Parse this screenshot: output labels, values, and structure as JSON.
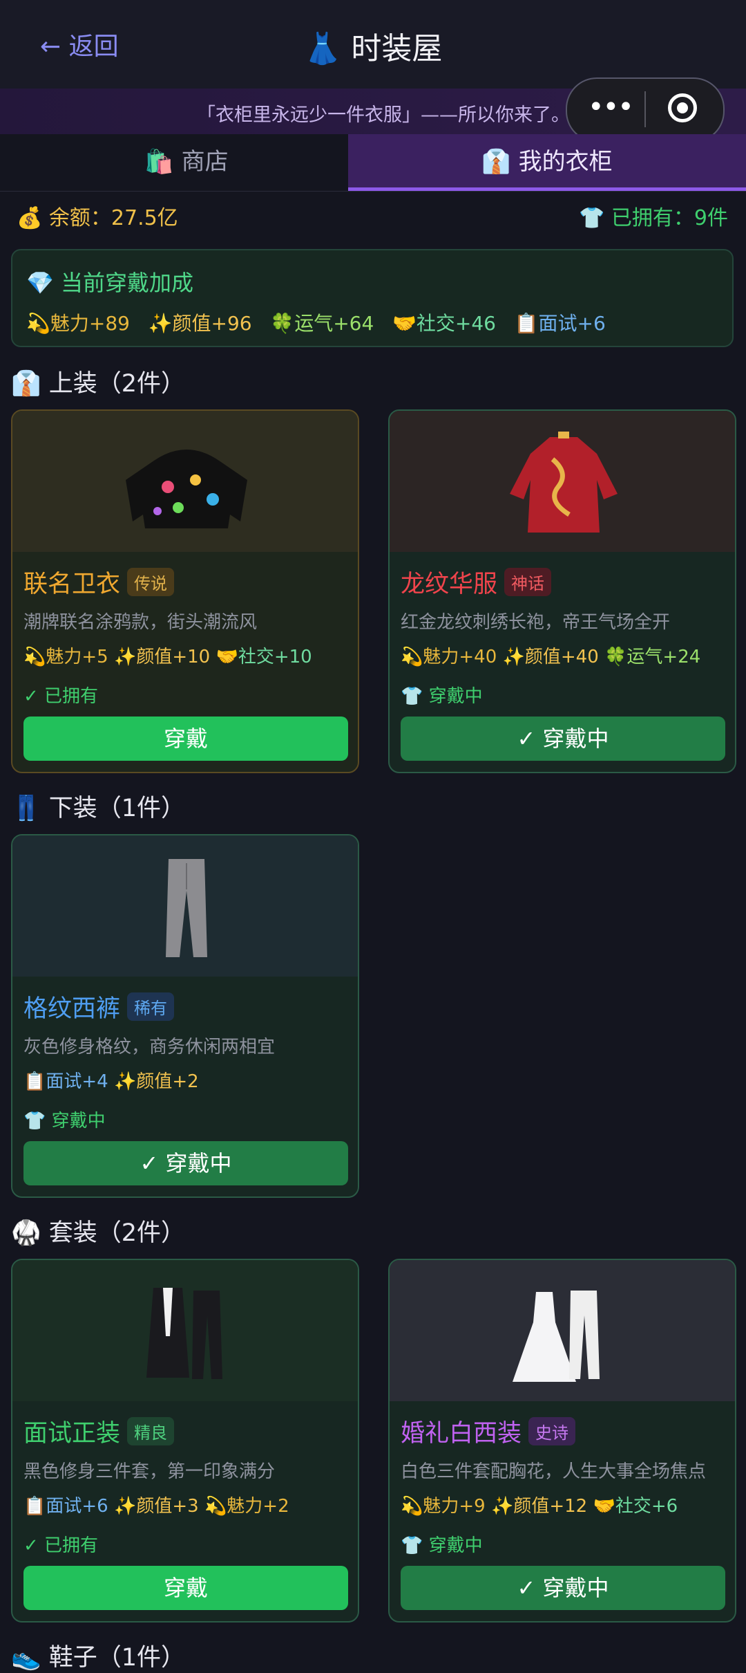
{
  "header": {
    "back_label": "← 返回",
    "title": "👗 时装屋"
  },
  "banner": {
    "quote": "「衣柜里永远少一件衣服」——所以你来了。"
  },
  "tabs": [
    {
      "label": "🛍️ 商店"
    },
    {
      "label": "👔 我的衣柜"
    }
  ],
  "stats": {
    "balance": "💰 余额：27.5亿",
    "owned": "👕 已拥有：9件"
  },
  "bonus": {
    "title": "💎 当前穿戴加成",
    "items": [
      {
        "label": "💫魅力+89",
        "color": "#e8b73c"
      },
      {
        "label": "✨颜值+96",
        "color": "#f2c24f"
      },
      {
        "label": "🍀运气+64",
        "color": "#9be06a"
      },
      {
        "label": "🤝社交+46",
        "color": "#6fdca0"
      },
      {
        "label": "📋面试+6",
        "color": "#6fb0ee"
      }
    ]
  },
  "sections": {
    "tops": "👔 上装（2件）",
    "bottoms": "👖 下装（1件）",
    "suits": "🥋 套装（2件）",
    "shoes": "👟 鞋子（1件）"
  },
  "cards": [
    {
      "name": "联名卫衣",
      "rarity": "传说",
      "desc": "潮牌联名涂鸦款，街头潮流风",
      "attrs": [
        {
          "t": "💫魅力+5",
          "c": "#e8b73c"
        },
        {
          "t": "✨颜值+10",
          "c": "#f2c24f"
        },
        {
          "t": "🤝社交+10",
          "c": "#6fdca0"
        }
      ],
      "status": "✓ 已拥有",
      "button": "穿戴",
      "name_color": "#f0a830"
    },
    {
      "name": "龙纹华服",
      "rarity": "神话",
      "desc": "红金龙纹刺绣长袍，帝王气场全开",
      "attrs": [
        {
          "t": "💫魅力+40",
          "c": "#e8b73c"
        },
        {
          "t": "✨颜值+40",
          "c": "#f2c24f"
        },
        {
          "t": "🍀运气+24",
          "c": "#9be06a"
        }
      ],
      "status": "👕 穿戴中",
      "button": "✓ 穿戴中",
      "name_color": "#f0444c"
    },
    {
      "name": "格纹西裤",
      "rarity": "稀有",
      "desc": "灰色修身格纹，商务休闲两相宜",
      "attrs": [
        {
          "t": "📋面试+4",
          "c": "#6fb0ee"
        },
        {
          "t": "✨颜值+2",
          "c": "#f2c24f"
        }
      ],
      "status": "👕 穿戴中",
      "button": "✓ 穿戴中",
      "name_color": "#4f9ef2"
    },
    {
      "name": "面试正装",
      "rarity": "精良",
      "desc": "黑色修身三件套，第一印象满分",
      "attrs": [
        {
          "t": "📋面试+6",
          "c": "#6fb0ee"
        },
        {
          "t": "✨颜值+3",
          "c": "#f2c24f"
        },
        {
          "t": "💫魅力+2",
          "c": "#e8b73c"
        }
      ],
      "status": "✓ 已拥有",
      "button": "穿戴",
      "name_color": "#3fcf6e"
    },
    {
      "name": "婚礼白西装",
      "rarity": "史诗",
      "desc": "白色三件套配胸花，人生大事全场焦点",
      "attrs": [
        {
          "t": "💫魅力+9",
          "c": "#e8b73c"
        },
        {
          "t": "✨颜值+12",
          "c": "#f2c24f"
        },
        {
          "t": "🤝社交+6",
          "c": "#6fdca0"
        }
      ],
      "status": "👕 穿戴中",
      "button": "✓ 穿戴中",
      "name_color": "#c062f0"
    }
  ]
}
